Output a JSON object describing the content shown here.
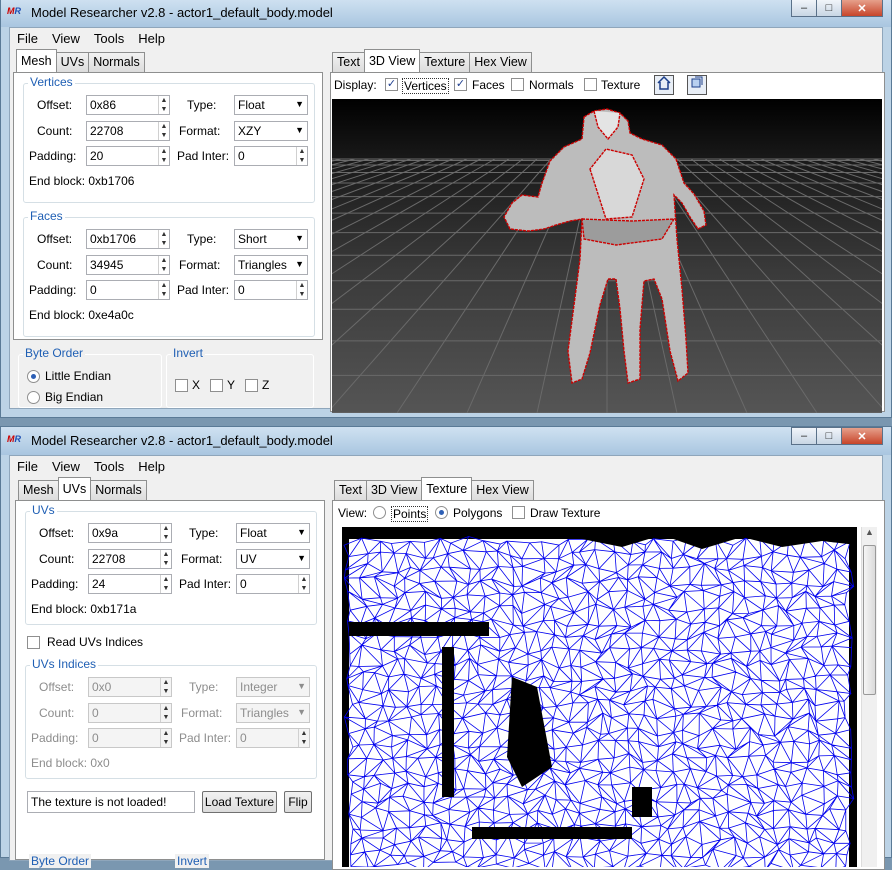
{
  "window1": {
    "title": "Model Researcher v2.8 - actor1_default_body.model",
    "app_icon": "MR",
    "menu": [
      "File",
      "View",
      "Tools",
      "Help"
    ],
    "left_tabs": [
      "Mesh",
      "UVs",
      "Normals"
    ],
    "active_left_tab": "Mesh",
    "vertices": {
      "title": "Vertices",
      "offset_label": "Offset:",
      "offset": "0x86",
      "count_label": "Count:",
      "count": "22708",
      "padding_label": "Padding:",
      "padding": "20",
      "type_label": "Type:",
      "type": "Float",
      "format_label": "Format:",
      "format": "XZY",
      "padinter_label": "Pad Inter:",
      "padinter": "0",
      "endblock": "End block: 0xb1706"
    },
    "faces": {
      "title": "Faces",
      "offset_label": "Offset:",
      "offset": "0xb1706",
      "count_label": "Count:",
      "count": "34945",
      "padding_label": "Padding:",
      "padding": "0",
      "type_label": "Type:",
      "type": "Short",
      "format_label": "Format:",
      "format": "Triangles",
      "padinter_label": "Pad Inter:",
      "padinter": "0",
      "endblock": "End block: 0xe4a0c"
    },
    "byte_order": {
      "title": "Byte Order",
      "little": "Little Endian",
      "big": "Big Endian",
      "selected": "Little Endian"
    },
    "invert": {
      "title": "Invert",
      "x": "X",
      "y": "Y",
      "z": "Z"
    },
    "right_tabs": [
      "Text",
      "3D View",
      "Texture",
      "Hex View"
    ],
    "active_right_tab": "3D View",
    "display": {
      "label": "Display:",
      "vertices": "Vertices",
      "vertices_checked": true,
      "faces": "Faces",
      "faces_checked": true,
      "normals": "Normals",
      "normals_checked": false,
      "texture": "Texture",
      "texture_checked": false
    }
  },
  "window2": {
    "title": "Model Researcher v2.8 - actor1_default_body.model",
    "app_icon": "MR",
    "menu": [
      "File",
      "View",
      "Tools",
      "Help"
    ],
    "left_tabs": [
      "Mesh",
      "UVs",
      "Normals"
    ],
    "active_left_tab": "UVs",
    "uvs": {
      "title": "UVs",
      "offset_label": "Offset:",
      "offset": "0x9a",
      "count_label": "Count:",
      "count": "22708",
      "padding_label": "Padding:",
      "padding": "24",
      "type_label": "Type:",
      "type": "Float",
      "format_label": "Format:",
      "format": "UV",
      "padinter_label": "Pad Inter:",
      "padinter": "0",
      "endblock": "End block: 0xb171a"
    },
    "read_indices": "Read UVs Indices",
    "uv_indices": {
      "title": "UVs Indices",
      "offset_label": "Offset:",
      "offset": "0x0",
      "count_label": "Count:",
      "count": "0",
      "padding_label": "Padding:",
      "padding": "0",
      "type_label": "Type:",
      "type": "Integer",
      "format_label": "Format:",
      "format": "Triangles",
      "padinter_label": "Pad Inter:",
      "padinter": "0",
      "endblock": "End block: 0x0"
    },
    "texture_status": "The texture is not loaded!",
    "load_texture": "Load Texture",
    "flip": "Flip",
    "byte_order_title": "Byte Order",
    "invert_title": "Invert",
    "right_tabs": [
      "Text",
      "3D View",
      "Texture",
      "Hex View"
    ],
    "active_right_tab": "Texture",
    "view": {
      "label": "View:",
      "points": "Points",
      "polygons": "Polygons",
      "draw_texture": "Draw Texture",
      "selected": "Polygons"
    }
  },
  "colors": {
    "vertex_outline": "#cc0000",
    "uv_wire": "#0000ee",
    "floor_grid": "#6a6a6a",
    "accent": "#1f5fb4"
  }
}
